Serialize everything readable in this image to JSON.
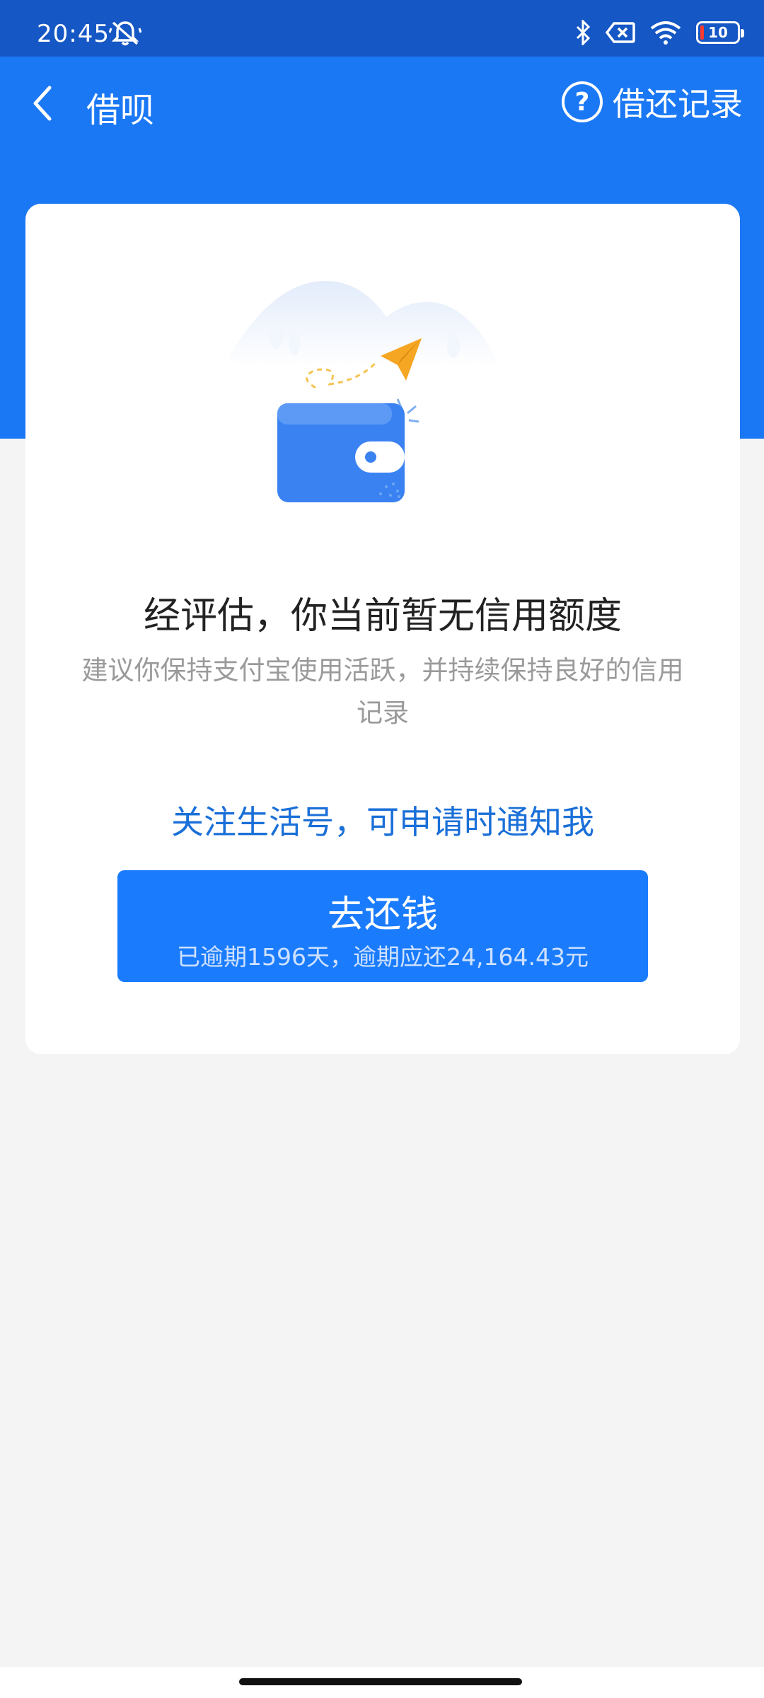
{
  "status_bar": {
    "time": "20:45",
    "battery_level": "10",
    "icons": [
      "mute-bell-icon",
      "bluetooth-icon",
      "no-sim-icon",
      "wifi-icon",
      "battery-icon"
    ]
  },
  "nav": {
    "title": "借呗",
    "record_link": "借还记录",
    "back_icon": "chevron-left-icon",
    "help_icon_glyph": "?"
  },
  "card": {
    "headline": "经评估，你当前暂无信用额度",
    "subtext": "建议你保持支付宝使用活跃，并持续保持良好的信用记录",
    "follow_link": "关注生活号，可申请时通知我",
    "repay_button": {
      "label": "去还钱",
      "sub_label": "已逾期1596天，逾期应还24,164.43元"
    }
  },
  "colors": {
    "primary_blue": "#1b78f5",
    "status_bar_blue": "#1557c4",
    "button_blue": "#1a7cfd",
    "link_blue": "#1a6fd8",
    "paper_plane": "#f5a623"
  }
}
